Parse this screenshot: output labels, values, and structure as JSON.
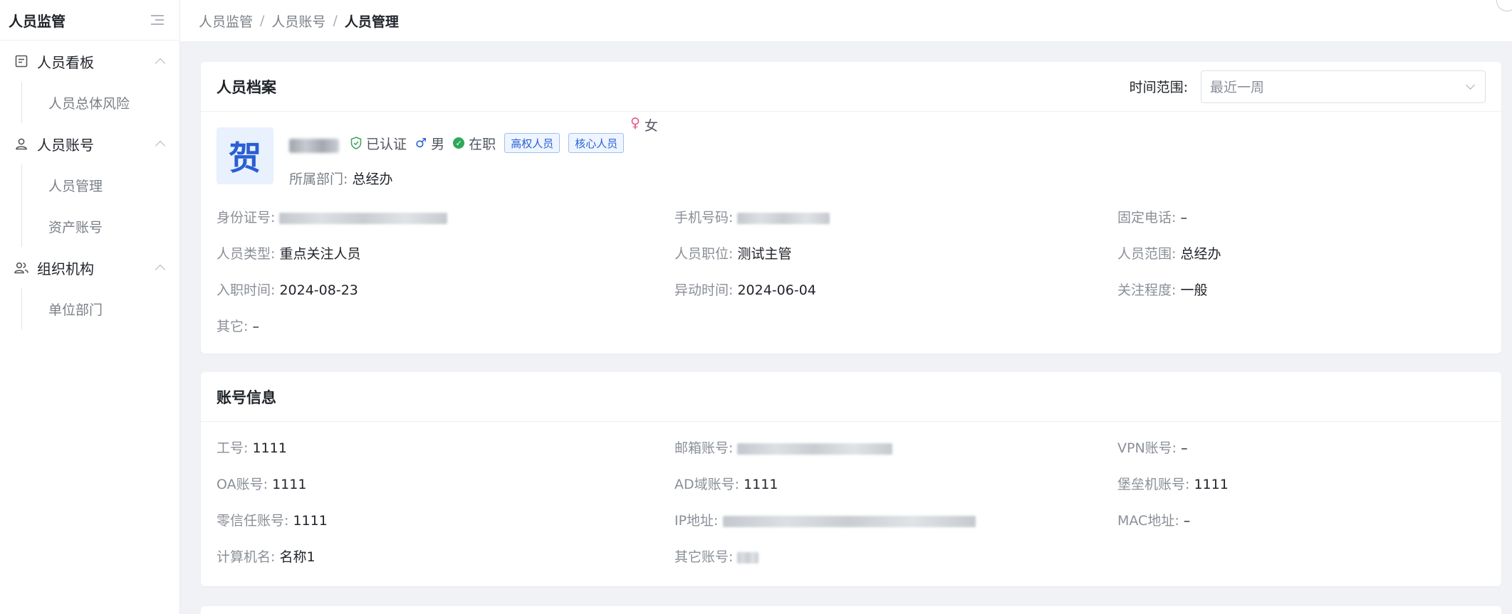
{
  "sidebar": {
    "title": "人员监管",
    "groups": [
      {
        "label": "人员看板",
        "icon": "board-icon",
        "items": [
          "人员总体风险"
        ]
      },
      {
        "label": "人员账号",
        "icon": "user-icon",
        "items": [
          "人员管理",
          "资产账号"
        ]
      },
      {
        "label": "组织机构",
        "icon": "users-icon",
        "items": [
          "单位部门"
        ]
      }
    ]
  },
  "breadcrumb": {
    "items": [
      "人员监管",
      "人员账号"
    ],
    "current": "人员管理",
    "separator": "/"
  },
  "profile_card": {
    "title": "人员档案",
    "time_range_label": "时间范围:",
    "time_range_value": "最近一周",
    "avatar_char": "贺",
    "certified": "已认证",
    "gender_female": "女",
    "gender_male": "男",
    "employment_status": "在职",
    "tags": [
      "高权人员",
      "核心人员"
    ],
    "dept_label": "所属部门:",
    "dept_value": "总经办",
    "fields": {
      "id_label": "身份证号:",
      "phone_label": "手机号码:",
      "landline_label": "固定电话:",
      "landline_value": "–",
      "type_label": "人员类型:",
      "type_value": "重点关注人员",
      "position_label": "人员职位:",
      "position_value": "测试主管",
      "scope_label": "人员范围:",
      "scope_value": "总经办",
      "join_label": "入职时间:",
      "join_value": "2024-08-23",
      "change_label": "异动时间:",
      "change_value": "2024-06-04",
      "attention_label": "关注程度:",
      "attention_value": "一般",
      "other_label": "其它:",
      "other_value": "–"
    }
  },
  "account_card": {
    "title": "账号信息",
    "fields": {
      "emp_no_label": "工号:",
      "emp_no_value": "1111",
      "email_label": "邮箱账号:",
      "vpn_label": "VPN账号:",
      "vpn_value": "–",
      "oa_label": "OA账号:",
      "oa_value": "1111",
      "ad_label": "AD域账号:",
      "ad_value": "1111",
      "bastion_label": "堡垒机账号:",
      "bastion_value": "1111",
      "zt_label": "零信任账号:",
      "zt_value": "1111",
      "ip_label": "IP地址:",
      "mac_label": "MAC地址:",
      "mac_value": "–",
      "pc_label": "计算机名:",
      "pc_value": "名称1",
      "other_acc_label": "其它账号:"
    }
  }
}
